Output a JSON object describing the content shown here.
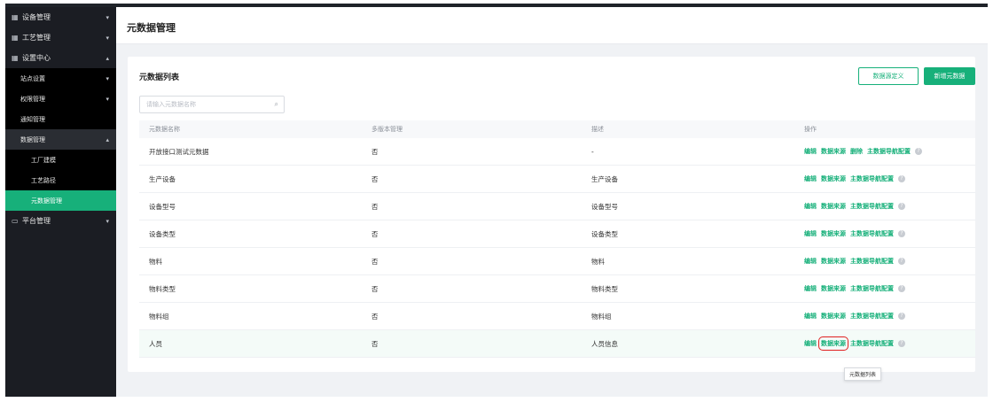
{
  "sidebar": {
    "items": [
      {
        "label": "设备管理",
        "icon": "grid-icon"
      },
      {
        "label": "工艺管理",
        "icon": "grid-icon"
      },
      {
        "label": "设置中心",
        "icon": "grid-icon"
      },
      {
        "label": "站点设置"
      },
      {
        "label": "权限管理"
      },
      {
        "label": "通知管理"
      },
      {
        "label": "数据管理"
      },
      {
        "label": "工厂建模"
      },
      {
        "label": "工艺路径"
      },
      {
        "label": "元数据管理"
      },
      {
        "label": "平台管理",
        "icon": "monitor-icon"
      }
    ]
  },
  "header": {
    "title": "元数据管理"
  },
  "card": {
    "title": "元数据列表",
    "btn_datasource": "数据源定义",
    "btn_add": "新增元数据"
  },
  "search": {
    "placeholder": "请输入元数据名称"
  },
  "table": {
    "columns": [
      "元数据名称",
      "多版本管理",
      "描述",
      "操作"
    ],
    "rows": [
      {
        "name": "开放接口测试元数据",
        "multi": "否",
        "desc": "-",
        "ops": [
          "编辑",
          "数据来源",
          "删除",
          "主数据导航配置"
        ]
      },
      {
        "name": "生产设备",
        "multi": "否",
        "desc": "生产设备",
        "ops": [
          "编辑",
          "数据来源",
          "主数据导航配置"
        ]
      },
      {
        "name": "设备型号",
        "multi": "否",
        "desc": "设备型号",
        "ops": [
          "编辑",
          "数据来源",
          "主数据导航配置"
        ]
      },
      {
        "name": "设备类型",
        "multi": "否",
        "desc": "设备类型",
        "ops": [
          "编辑",
          "数据来源",
          "主数据导航配置"
        ]
      },
      {
        "name": "物料",
        "multi": "否",
        "desc": "物料",
        "ops": [
          "编辑",
          "数据来源",
          "主数据导航配置"
        ]
      },
      {
        "name": "物料类型",
        "multi": "否",
        "desc": "物料类型",
        "ops": [
          "编辑",
          "数据来源",
          "主数据导航配置"
        ]
      },
      {
        "name": "物料组",
        "multi": "否",
        "desc": "物料组",
        "ops": [
          "编辑",
          "数据来源",
          "主数据导航配置"
        ]
      },
      {
        "name": "人员",
        "multi": "否",
        "desc": "人员信息",
        "ops": [
          "编辑",
          "数据来源",
          "主数据导航配置"
        ]
      }
    ]
  },
  "tooltip": "元数据列表",
  "colors": {
    "accent": "#17b07a",
    "sidebar_bg": "#1b1d23",
    "highlight": "#e02020"
  }
}
